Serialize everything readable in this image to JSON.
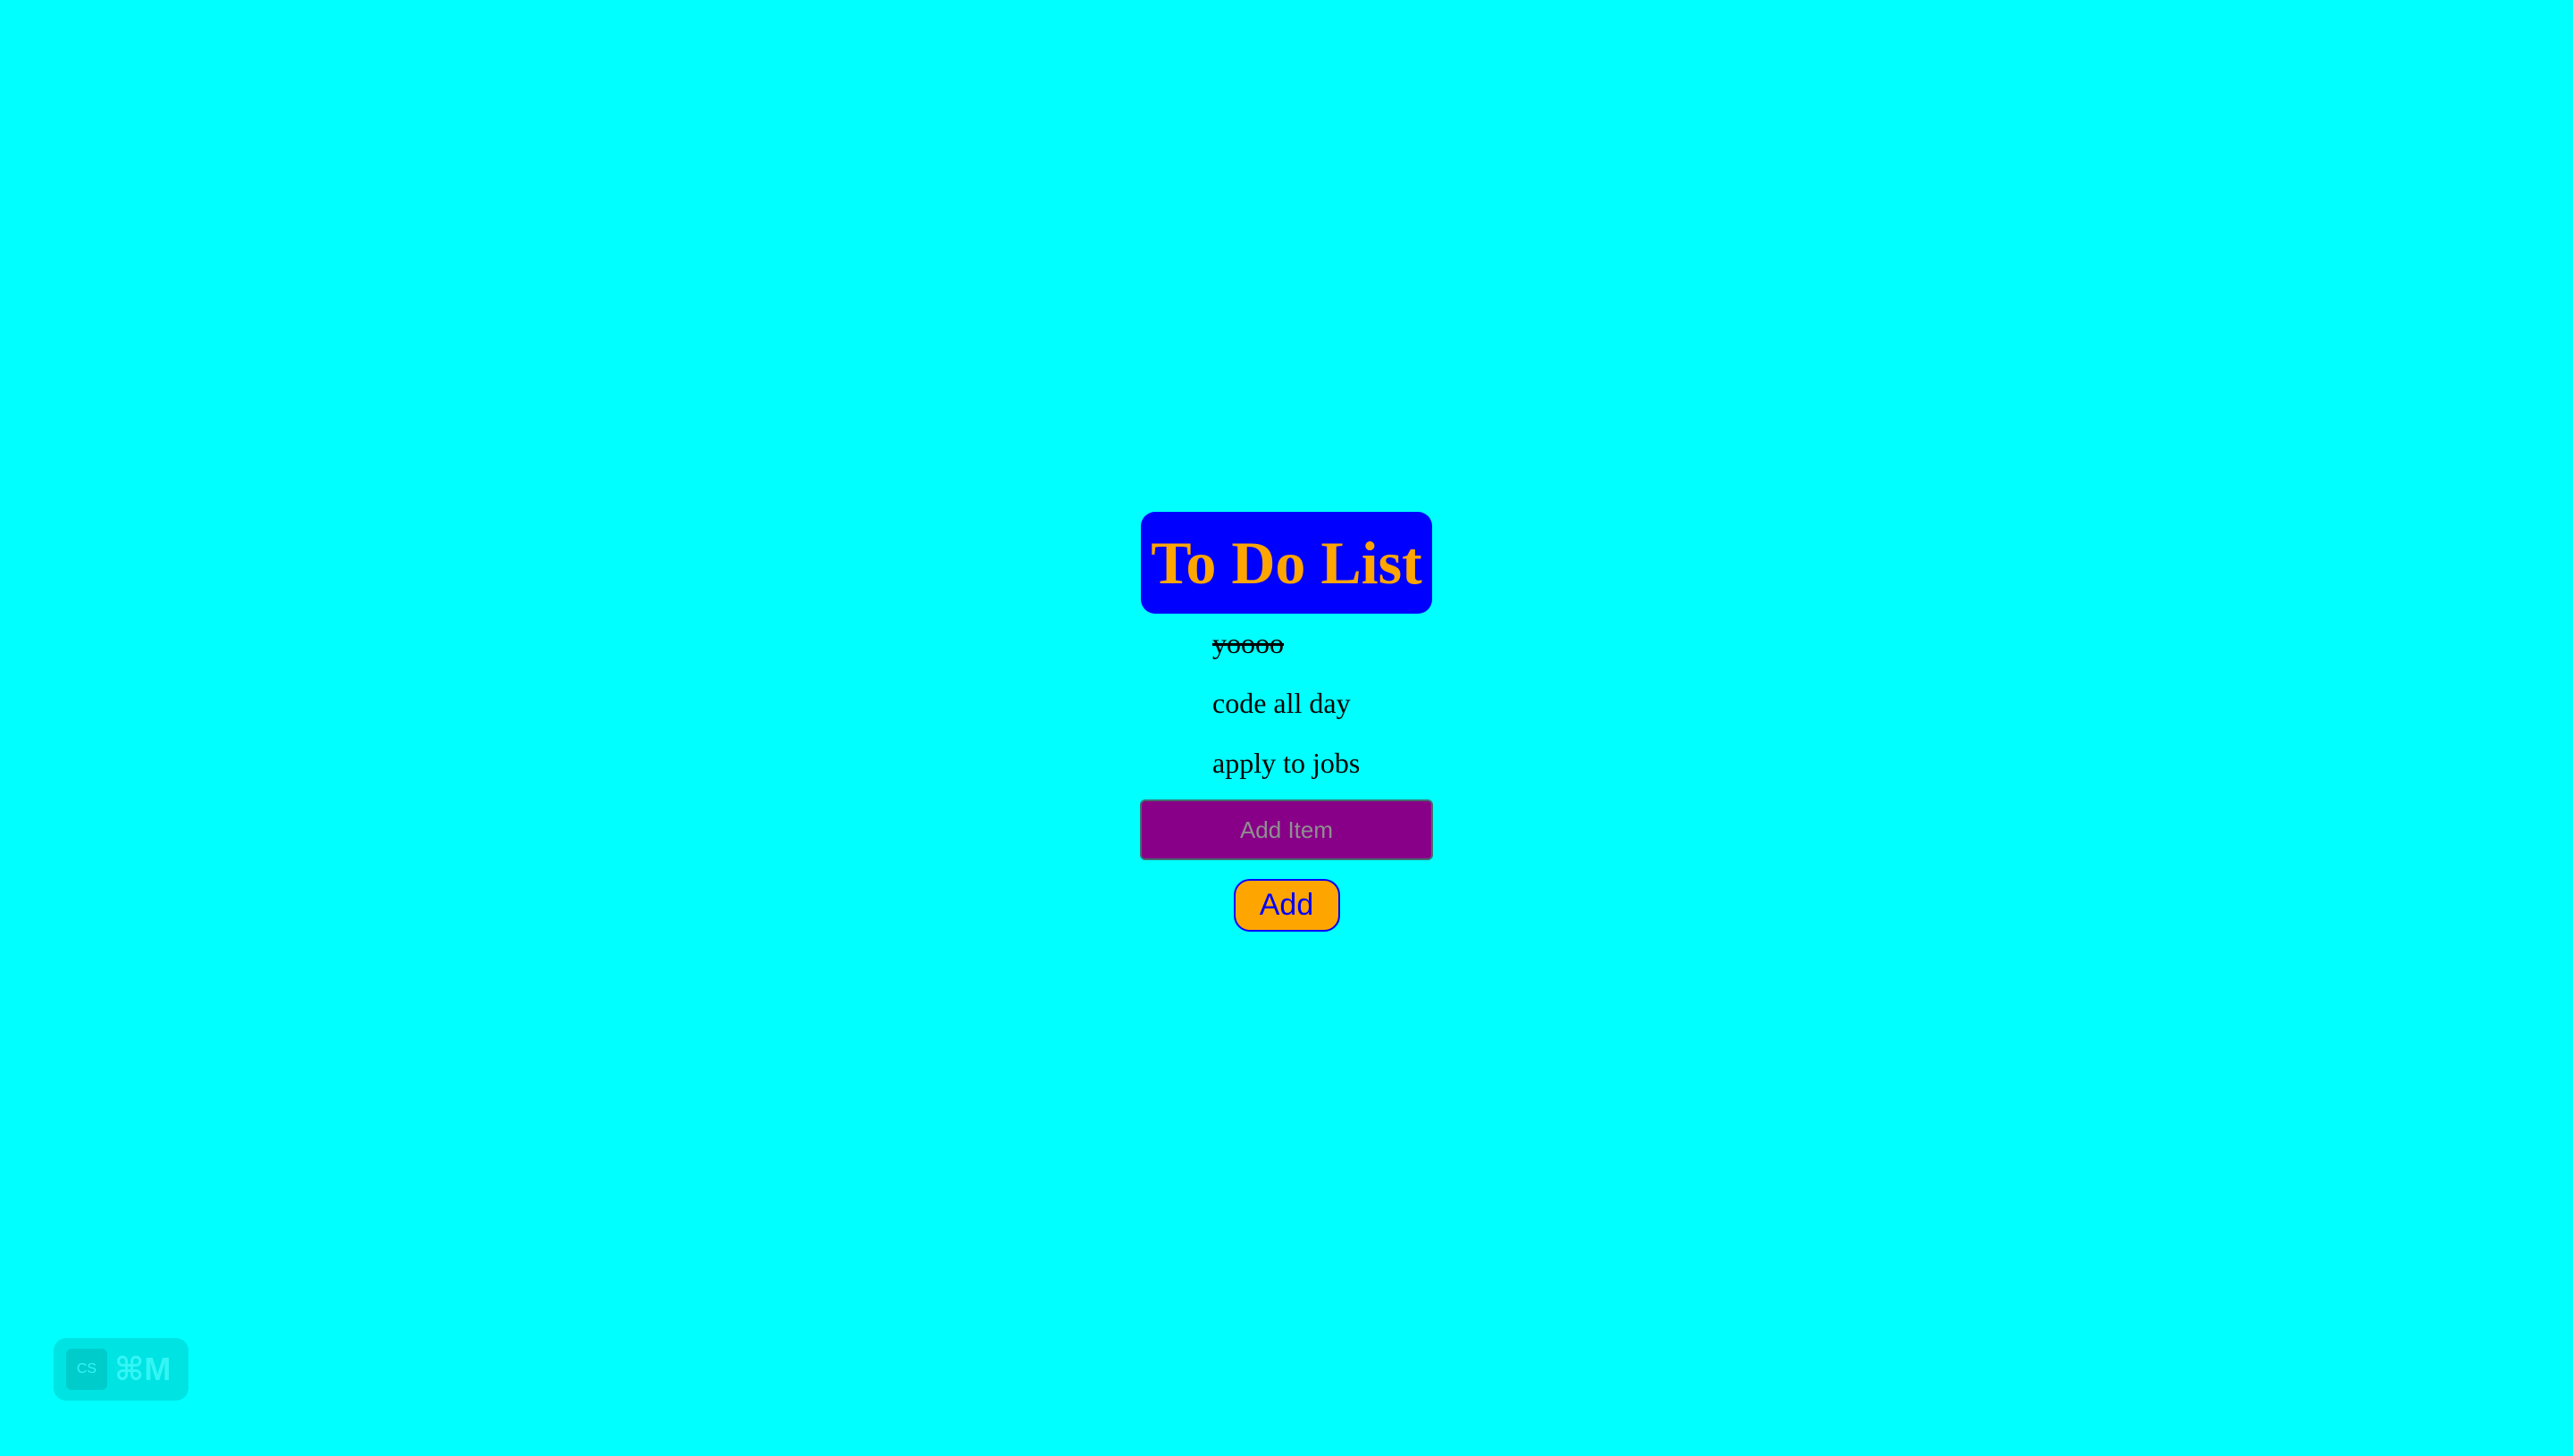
{
  "app": {
    "title": "To Do List"
  },
  "todos": [
    {
      "text": "yoooo",
      "done": true
    },
    {
      "text": "code all day",
      "done": false
    },
    {
      "text": "apply to jobs",
      "done": false
    }
  ],
  "add_form": {
    "placeholder": "Add Item",
    "value": "",
    "button_label": "Add"
  },
  "shortcut_badge": {
    "logo_text": "CS",
    "keys": "⌘M"
  },
  "colors": {
    "background": "#00ffff",
    "title_bg": "#0000ff",
    "title_text": "#ffa500",
    "input_bg": "#880088",
    "button_bg": "#ffa500",
    "button_text": "#0000ff"
  }
}
